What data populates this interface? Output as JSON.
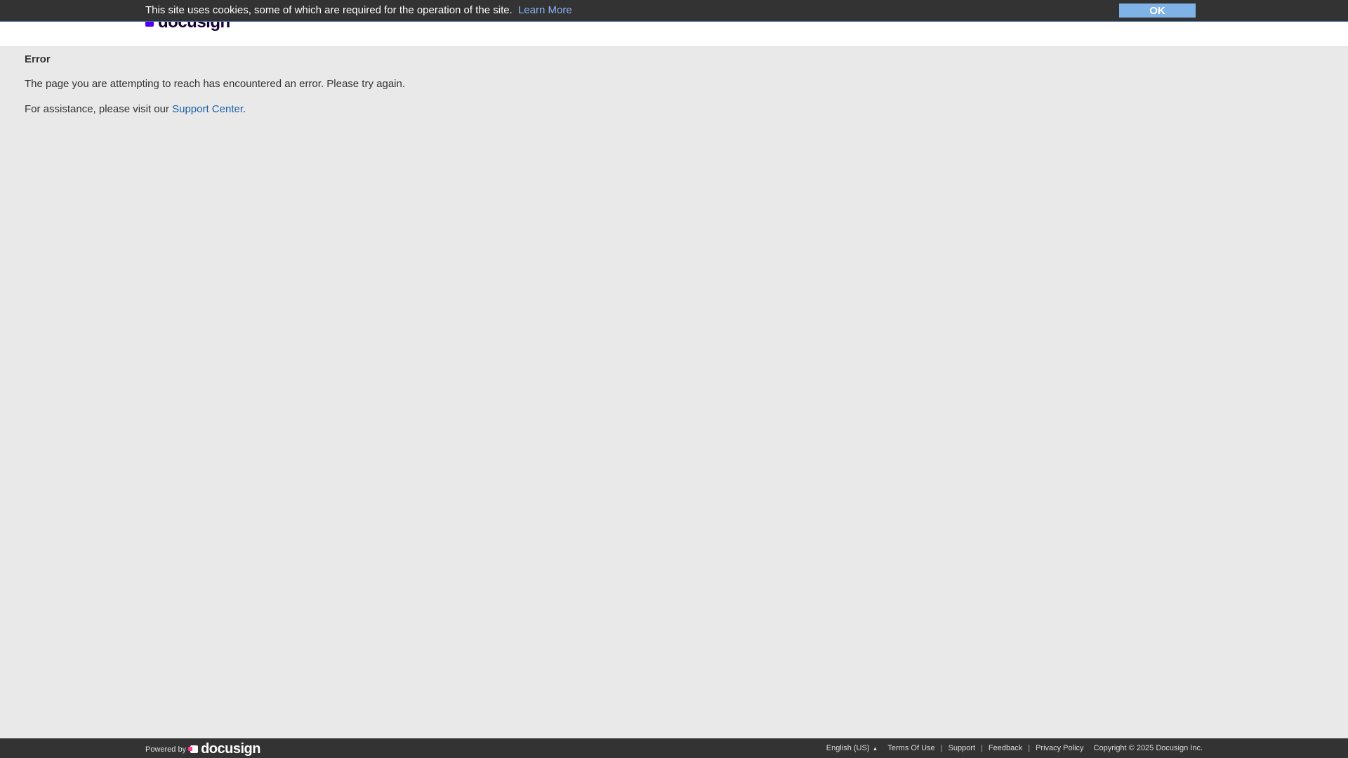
{
  "header": {
    "brand_name": "docusign"
  },
  "cookie_banner": {
    "message": "This site uses cookies, some of which are required for the operation of the site.",
    "learn_more": "Learn More",
    "ok_label": "OK"
  },
  "main": {
    "title": "Error",
    "message": "The page you are attempting to reach has encountered an error. Please try again.",
    "assistance_prefix": "For assistance, please visit our ",
    "support_link": "Support Center",
    "assistance_suffix": "."
  },
  "footer": {
    "powered_by": "Powered by",
    "brand_name": "docusign",
    "language": "English (US)",
    "language_icon": "caret-up-icon",
    "links": [
      "Terms Of Use",
      "Support",
      "Feedback",
      "Privacy Policy"
    ],
    "separator": "|",
    "copyright": "Copyright © 2025 Docusign Inc."
  },
  "colors": {
    "background": "#e9e9e9",
    "banner": "#333333",
    "ok_button": "#7fb3e8",
    "link": "#1a5fa8",
    "brand_mark": "#4c00ff"
  }
}
